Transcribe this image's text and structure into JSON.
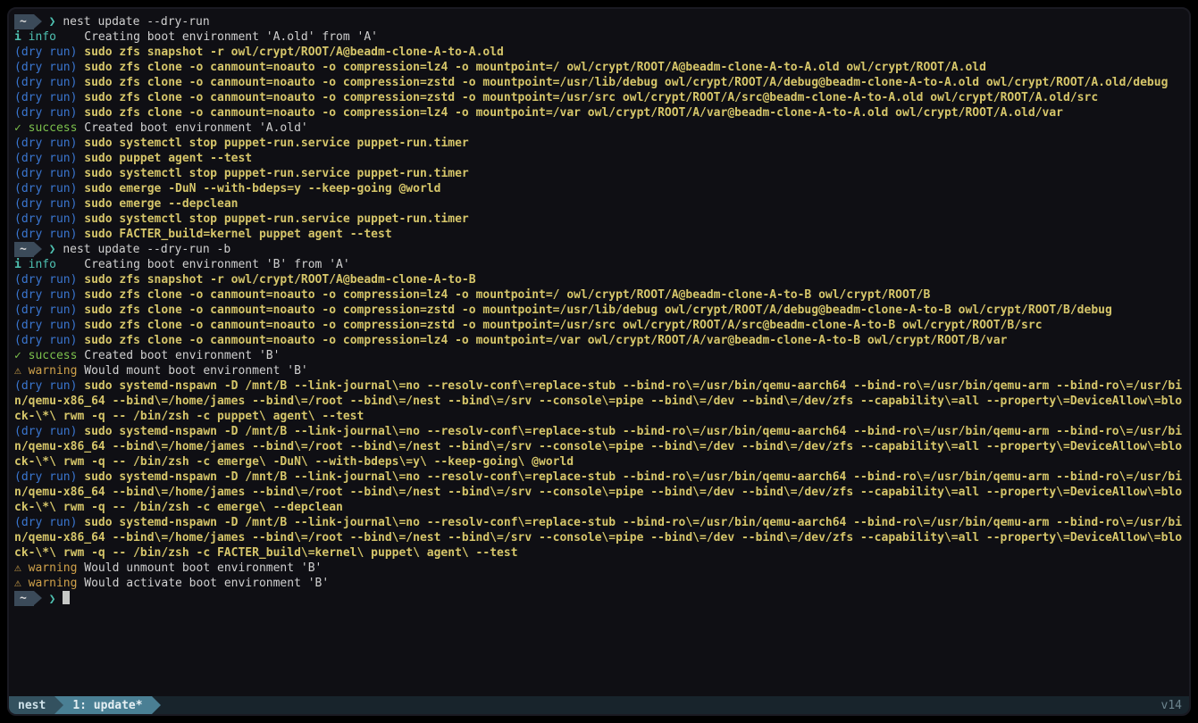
{
  "prompt": {
    "home": "~"
  },
  "commands": {
    "cmd1": "nest update --dry-run",
    "cmd2": "nest update --dry-run -b"
  },
  "labels": {
    "info_sym": "i",
    "info": "info",
    "success_sym": "✓",
    "success": "success",
    "warning_sym": "⚠",
    "warning": "warning",
    "dryrun": "(dry run)"
  },
  "info_msg": {
    "a": "Creating boot environment 'A.old' from 'A'",
    "b": "Creating boot environment 'B' from 'A'"
  },
  "success_msg": {
    "a": "Created boot environment 'A.old'",
    "b": "Created boot environment 'B'"
  },
  "warning_msg": {
    "mount_b": "Would mount boot environment 'B'",
    "umount_b": "Would unmount boot environment 'B'",
    "activate_b": "Would activate boot environment 'B'"
  },
  "runA": {
    "l1": "sudo zfs snapshot -r owl/crypt/ROOT/A@beadm-clone-A-to-A.old",
    "l2": "sudo zfs clone -o canmount=noauto -o compression=lz4 -o mountpoint=/ owl/crypt/ROOT/A@beadm-clone-A-to-A.old owl/crypt/ROOT/A.old",
    "l3": "sudo zfs clone -o canmount=noauto -o compression=zstd -o mountpoint=/usr/lib/debug owl/crypt/ROOT/A/debug@beadm-clone-A-to-A.old owl/crypt/ROOT/A.old/debug",
    "l4": "sudo zfs clone -o canmount=noauto -o compression=zstd -o mountpoint=/usr/src owl/crypt/ROOT/A/src@beadm-clone-A-to-A.old owl/crypt/ROOT/A.old/src",
    "l5": "sudo zfs clone -o canmount=noauto -o compression=lz4 -o mountpoint=/var owl/crypt/ROOT/A/var@beadm-clone-A-to-A.old owl/crypt/ROOT/A.old/var",
    "l6": "sudo systemctl stop puppet-run.service puppet-run.timer",
    "l7": "sudo puppet agent --test",
    "l8": "sudo systemctl stop puppet-run.service puppet-run.timer",
    "l9": "sudo emerge -DuN --with-bdeps=y --keep-going @world",
    "l10": "sudo emerge --depclean",
    "l11": "sudo systemctl stop puppet-run.service puppet-run.timer",
    "l12": "sudo FACTER_build=kernel puppet agent --test"
  },
  "runB": {
    "l1": "sudo zfs snapshot -r owl/crypt/ROOT/A@beadm-clone-A-to-B",
    "l2": "sudo zfs clone -o canmount=noauto -o compression=lz4 -o mountpoint=/ owl/crypt/ROOT/A@beadm-clone-A-to-B owl/crypt/ROOT/B",
    "l3": "sudo zfs clone -o canmount=noauto -o compression=zstd -o mountpoint=/usr/lib/debug owl/crypt/ROOT/A/debug@beadm-clone-A-to-B owl/crypt/ROOT/B/debug",
    "l4": "sudo zfs clone -o canmount=noauto -o compression=zstd -o mountpoint=/usr/src owl/crypt/ROOT/A/src@beadm-clone-A-to-B owl/crypt/ROOT/B/src",
    "l5": "sudo zfs clone -o canmount=noauto -o compression=lz4 -o mountpoint=/var owl/crypt/ROOT/A/var@beadm-clone-A-to-B owl/crypt/ROOT/B/var",
    "n1": "sudo systemd-nspawn -D /mnt/B --link-journal\\=no --resolv-conf\\=replace-stub --bind-ro\\=/usr/bin/qemu-aarch64 --bind-ro\\=/usr/bin/qemu-arm --bind-ro\\=/usr/bin/qemu-x86_64 --bind\\=/home/james --bind\\=/root --bind\\=/nest --bind\\=/srv --console\\=pipe --bind\\=/dev --bind\\=/dev/zfs --capability\\=all --property\\=DeviceAllow\\=block-\\*\\ rwm -q -- /bin/zsh -c puppet\\ agent\\ --test",
    "n2": "sudo systemd-nspawn -D /mnt/B --link-journal\\=no --resolv-conf\\=replace-stub --bind-ro\\=/usr/bin/qemu-aarch64 --bind-ro\\=/usr/bin/qemu-arm --bind-ro\\=/usr/bin/qemu-x86_64 --bind\\=/home/james --bind\\=/root --bind\\=/nest --bind\\=/srv --console\\=pipe --bind\\=/dev --bind\\=/dev/zfs --capability\\=all --property\\=DeviceAllow\\=block-\\*\\ rwm -q -- /bin/zsh -c emerge\\ -DuN\\ --with-bdeps\\=y\\ --keep-going\\ @world",
    "n3": "sudo systemd-nspawn -D /mnt/B --link-journal\\=no --resolv-conf\\=replace-stub --bind-ro\\=/usr/bin/qemu-aarch64 --bind-ro\\=/usr/bin/qemu-arm --bind-ro\\=/usr/bin/qemu-x86_64 --bind\\=/home/james --bind\\=/root --bind\\=/nest --bind\\=/srv --console\\=pipe --bind\\=/dev --bind\\=/dev/zfs --capability\\=all --property\\=DeviceAllow\\=block-\\*\\ rwm -q -- /bin/zsh -c emerge\\ --depclean",
    "n4": "sudo systemd-nspawn -D /mnt/B --link-journal\\=no --resolv-conf\\=replace-stub --bind-ro\\=/usr/bin/qemu-aarch64 --bind-ro\\=/usr/bin/qemu-arm --bind-ro\\=/usr/bin/qemu-x86_64 --bind\\=/home/james --bind\\=/root --bind\\=/nest --bind\\=/srv --console\\=pipe --bind\\=/dev --bind\\=/dev/zfs --capability\\=all --property\\=DeviceAllow\\=block-\\*\\ rwm -q -- /bin/zsh -c FACTER_build\\=kernel\\ puppet\\ agent\\ --test"
  },
  "statusbar": {
    "host": "nest",
    "tab": "1: update*",
    "right": "v14"
  }
}
